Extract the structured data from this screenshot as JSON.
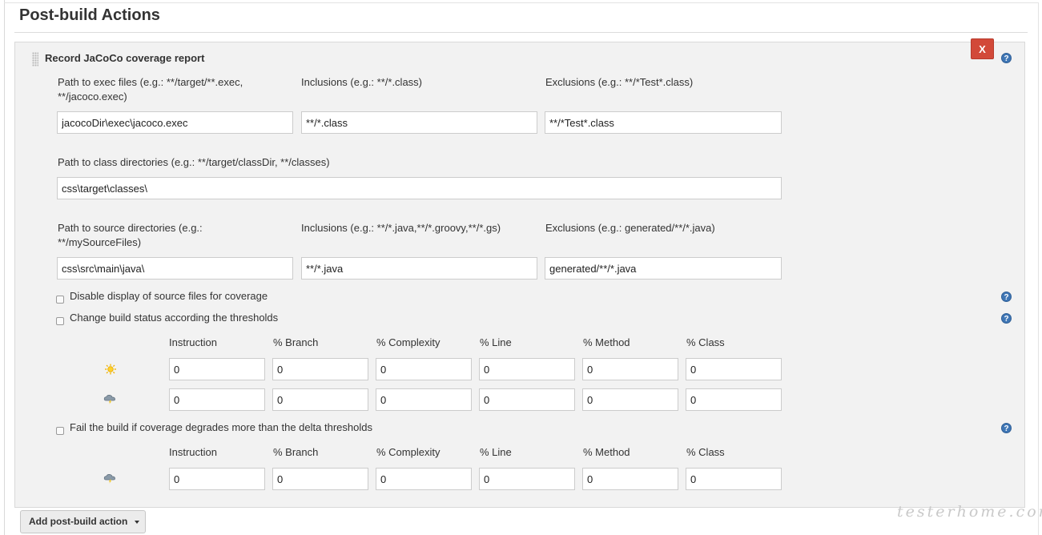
{
  "section": {
    "title": "Post-build Actions"
  },
  "panel": {
    "title": "Record JaCoCo coverage report",
    "close_label": "X",
    "help_glyph": "?"
  },
  "exec": {
    "path_label": "Path to exec files (e.g.: **/target/**.exec, **/jacoco.exec)",
    "path_value": "jacocoDir\\exec\\jacoco.exec",
    "inclusions_label": "Inclusions (e.g.: **/*.class)",
    "inclusions_value": "**/*.class",
    "exclusions_label": "Exclusions (e.g.: **/*Test*.class)",
    "exclusions_value": "**/*Test*.class"
  },
  "classdirs": {
    "label": "Path to class directories (e.g.: **/target/classDir, **/classes)",
    "value": "css\\target\\classes\\"
  },
  "source": {
    "path_label": "Path to source directories (e.g.: **/mySourceFiles)",
    "path_value": "css\\src\\main\\java\\",
    "inclusions_label": "Inclusions (e.g.: **/*.java,**/*.groovy,**/*.gs)",
    "inclusions_value": "**/*.java",
    "exclusions_label": "Exclusions (e.g.: generated/**/*.java)",
    "exclusions_value": "generated/**/*.java"
  },
  "options": {
    "disable_source": "Disable display of source files for coverage",
    "change_status": "Change build status according the thresholds",
    "fail_build": "Fail the build if coverage degrades more than the delta thresholds"
  },
  "thresholds": {
    "columns": [
      "Instruction",
      "% Branch",
      "% Complexity",
      "% Line",
      "% Method",
      "% Class"
    ],
    "sunny_icon": "sunny-weather-icon",
    "stormy_icon": "stormy-weather-icon",
    "sunny_values": [
      "0",
      "0",
      "0",
      "0",
      "0",
      "0"
    ],
    "stormy_values": [
      "0",
      "0",
      "0",
      "0",
      "0",
      "0"
    ]
  },
  "delta": {
    "columns": [
      "Instruction",
      "% Branch",
      "% Complexity",
      "% Line",
      "% Method",
      "% Class"
    ],
    "stormy_icon": "stormy-weather-icon",
    "values": [
      "0",
      "0",
      "0",
      "0",
      "0",
      "0"
    ]
  },
  "footer": {
    "add_button": "Add post-build action",
    "watermark": "testerhome.com"
  },
  "colors": {
    "close_button": "#d24939",
    "help_icon": "#3f76b5",
    "panel_background": "#f2f2f2"
  }
}
